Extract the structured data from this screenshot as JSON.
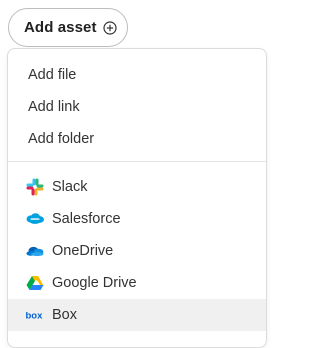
{
  "button": {
    "label": "Add asset",
    "icon": "plus-circle-icon"
  },
  "menu": {
    "basic_items": [
      {
        "label": "Add file"
      },
      {
        "label": "Add link"
      },
      {
        "label": "Add folder"
      }
    ],
    "integrations": [
      {
        "label": "Slack",
        "icon": "slack-icon"
      },
      {
        "label": "Salesforce",
        "icon": "salesforce-icon",
        "color": "#00a1e0"
      },
      {
        "label": "OneDrive",
        "icon": "onedrive-icon",
        "color": "#0364b8"
      },
      {
        "label": "Google Drive",
        "icon": "google-drive-icon"
      },
      {
        "label": "Box",
        "icon": "box-icon",
        "color": "#0061d5",
        "highlighted": true
      }
    ]
  }
}
